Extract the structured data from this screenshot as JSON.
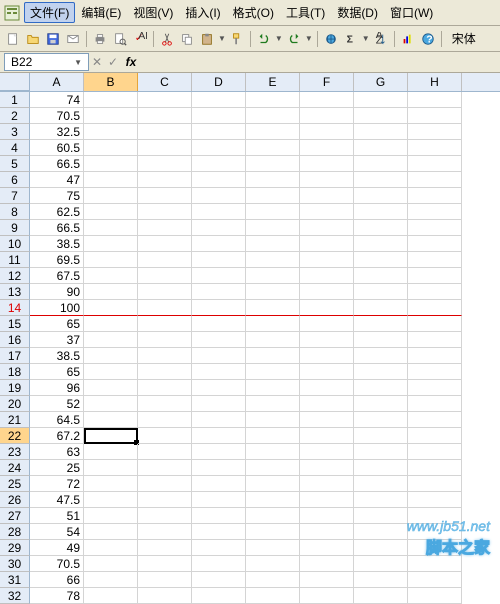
{
  "menu": {
    "file": "文件(F)",
    "edit": "编辑(E)",
    "view": "视图(V)",
    "insert": "插入(I)",
    "format": "格式(O)",
    "tools": "工具(T)",
    "data": "数据(D)",
    "window": "窗口(W)"
  },
  "formula_bar": {
    "name_box": "B22",
    "fx": "fx"
  },
  "font_name": "宋体",
  "columns": [
    "A",
    "B",
    "C",
    "D",
    "E",
    "F",
    "G",
    "H"
  ],
  "selected_col": "B",
  "selected_row": 22,
  "pagebreak_row": 14,
  "rows": [
    {
      "n": 1,
      "a": "74"
    },
    {
      "n": 2,
      "a": "70.5"
    },
    {
      "n": 3,
      "a": "32.5"
    },
    {
      "n": 4,
      "a": "60.5"
    },
    {
      "n": 5,
      "a": "66.5"
    },
    {
      "n": 6,
      "a": "47"
    },
    {
      "n": 7,
      "a": "75"
    },
    {
      "n": 8,
      "a": "62.5"
    },
    {
      "n": 9,
      "a": "66.5"
    },
    {
      "n": 10,
      "a": "38.5"
    },
    {
      "n": 11,
      "a": "69.5"
    },
    {
      "n": 12,
      "a": "67.5"
    },
    {
      "n": 13,
      "a": "90"
    },
    {
      "n": 14,
      "a": "100"
    },
    {
      "n": 15,
      "a": "65"
    },
    {
      "n": 16,
      "a": "37"
    },
    {
      "n": 17,
      "a": "38.5"
    },
    {
      "n": 18,
      "a": "65"
    },
    {
      "n": 19,
      "a": "96"
    },
    {
      "n": 20,
      "a": "52"
    },
    {
      "n": 21,
      "a": "64.5"
    },
    {
      "n": 22,
      "a": "67.2"
    },
    {
      "n": 23,
      "a": "63"
    },
    {
      "n": 24,
      "a": "25"
    },
    {
      "n": 25,
      "a": "72"
    },
    {
      "n": 26,
      "a": "47.5"
    },
    {
      "n": 27,
      "a": "51"
    },
    {
      "n": 28,
      "a": "54"
    },
    {
      "n": 29,
      "a": "49"
    },
    {
      "n": 30,
      "a": "70.5"
    },
    {
      "n": 31,
      "a": "66"
    },
    {
      "n": 32,
      "a": "78"
    }
  ],
  "watermark": {
    "url": "www.jb51.net",
    "name": "脚本之家"
  }
}
